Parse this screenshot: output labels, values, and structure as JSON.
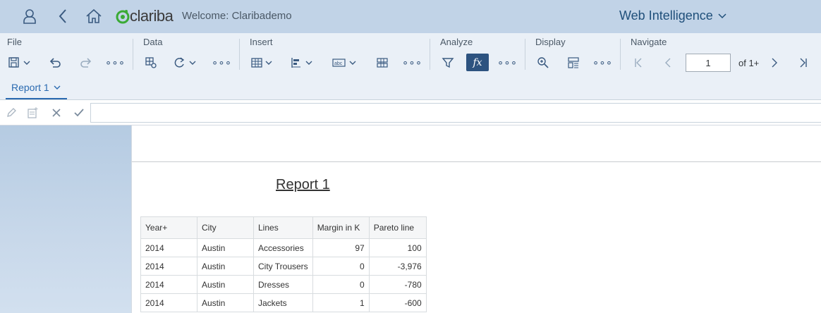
{
  "shell": {
    "brand": "clariba",
    "welcome": "Welcome: Claribademo",
    "app_title": "Web Intelligence"
  },
  "toolbar": {
    "groups": {
      "file": "File",
      "data": "Data",
      "insert": "Insert",
      "analyze": "Analyze",
      "display": "Display",
      "navigate": "Navigate"
    },
    "more": "∘∘∘",
    "fx_label": "fx",
    "page_value": "1",
    "of_pages": "of 1+"
  },
  "tabs": {
    "report_tab": "Report 1"
  },
  "report": {
    "title": "Report 1",
    "columns": [
      "Year+",
      "City",
      "Lines",
      "Margin in K",
      "Pareto line"
    ],
    "rows": [
      [
        "2014",
        "Austin",
        "Accessories",
        "97",
        "100"
      ],
      [
        "2014",
        "Austin",
        "City Trousers",
        "0",
        "-3,976"
      ],
      [
        "2014",
        "Austin",
        "Dresses",
        "0",
        "-780"
      ],
      [
        "2014",
        "Austin",
        "Jackets",
        "1",
        "-600"
      ]
    ]
  },
  "colors": {
    "shell_bg": "#c1d3e7",
    "toolbar_bg": "#eaf0f7",
    "accent": "#2d5380",
    "brand_green": "#3aaa35"
  }
}
